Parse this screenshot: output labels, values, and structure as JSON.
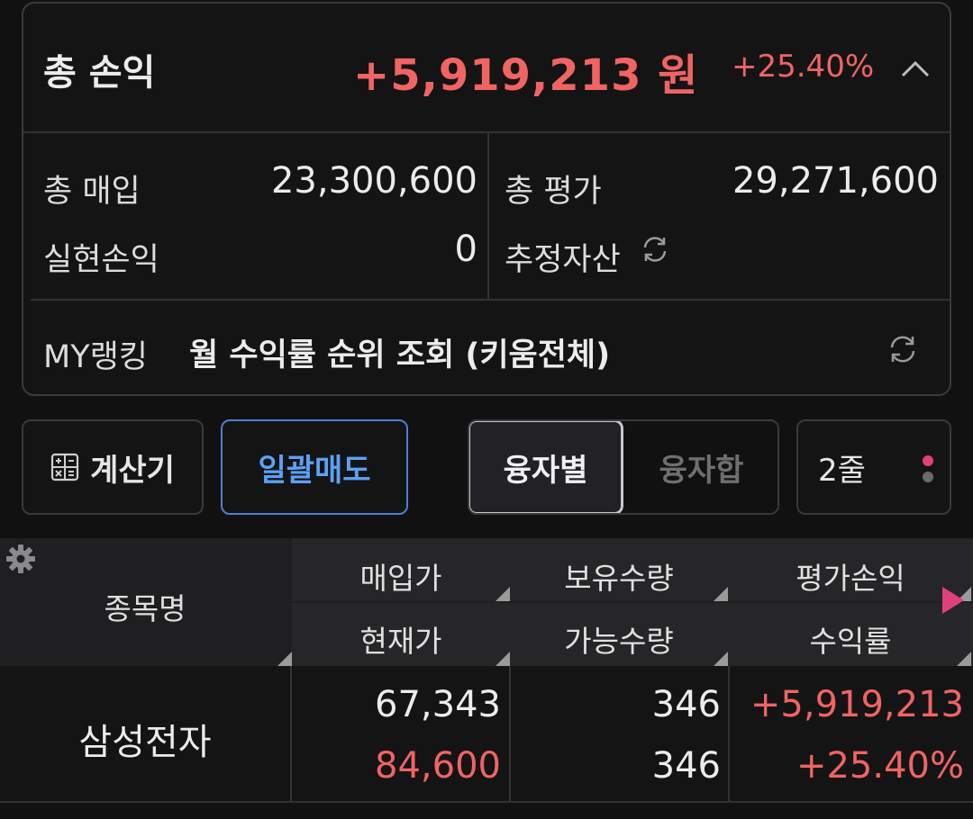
{
  "summary": {
    "total_pl_label": "총 손익",
    "total_pl_amount": "+5,919,213 원",
    "total_pl_rate": "+25.40%",
    "total_purchase_label": "총 매입",
    "total_purchase_value": "23,300,600",
    "total_eval_label": "총 평가",
    "total_eval_value": "29,271,600",
    "realized_pl_label": "실현손익",
    "realized_pl_value": "0",
    "estimated_assets_label": "추정자산"
  },
  "ranking": {
    "label": "MY랭킹",
    "text": "월 수익률 순위 조회 (키움전체)"
  },
  "toolbar": {
    "calculator_label": "계산기",
    "bulk_sell_label": "일괄매도",
    "segment_by_loan": "융자별",
    "segment_loan_sum": "융자합",
    "lines_label": "2줄"
  },
  "table": {
    "headers": {
      "stock_name": "종목명",
      "purchase_price": "매입가",
      "holding_qty": "보유수량",
      "eval_pl": "평가손익",
      "current_price": "현재가",
      "available_qty": "가능수량",
      "return_rate": "수익률"
    },
    "rows": [
      {
        "stock_name": "삼성전자",
        "purchase_price": "67,343",
        "current_price": "84,600",
        "holding_qty": "346",
        "available_qty": "346",
        "eval_pl": "+5,919,213",
        "return_rate": "+25.40%"
      }
    ]
  },
  "colors": {
    "background": "#111112",
    "profit_red": "#f06463",
    "accent_blue": "#5da0f5",
    "indicator_pink": "#e0407c"
  },
  "icons": [
    "chevron-up-icon",
    "refresh-icon",
    "calculator-icon",
    "gear-icon",
    "play-icon",
    "more-dots-icon"
  ]
}
